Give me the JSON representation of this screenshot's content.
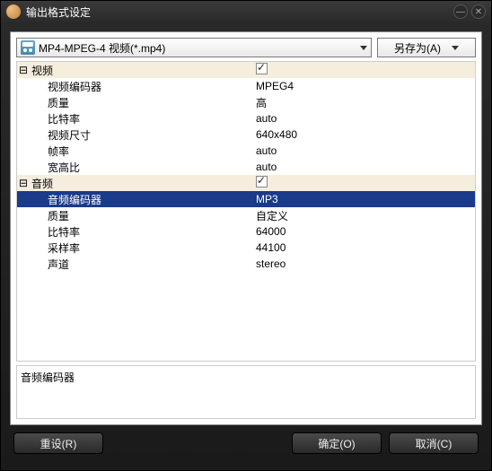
{
  "window": {
    "title": "输出格式设定"
  },
  "format": {
    "selected": "MP4-MPEG-4 视频(*.mp4)",
    "save_as": "另存为(A)"
  },
  "groups": [
    {
      "label": "视频",
      "checked": true,
      "rows": [
        {
          "name": "视频编码器",
          "value": "MPEG4"
        },
        {
          "name": "质量",
          "value": "高"
        },
        {
          "name": "比特率",
          "value": "auto"
        },
        {
          "name": "视频尺寸",
          "value": "640x480"
        },
        {
          "name": "帧率",
          "value": "auto"
        },
        {
          "name": "宽高比",
          "value": "auto"
        }
      ]
    },
    {
      "label": "音频",
      "checked": true,
      "rows": [
        {
          "name": "音频编码器",
          "value": "MP3",
          "selected": true
        },
        {
          "name": "质量",
          "value": "自定义"
        },
        {
          "name": "比特率",
          "value": "64000"
        },
        {
          "name": "采样率",
          "value": "44100"
        },
        {
          "name": "声道",
          "value": "stereo"
        }
      ]
    }
  ],
  "description": {
    "label": "音频编码器"
  },
  "footer": {
    "reset": "重设(R)",
    "ok": "确定(O)",
    "cancel": "取消(C)"
  }
}
